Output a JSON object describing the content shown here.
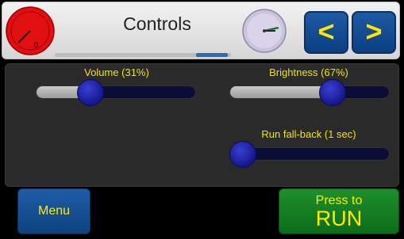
{
  "header": {
    "title": "Controls",
    "prev_label": "<",
    "next_label": ">",
    "gauge_label": "0",
    "gauge_icon": "speed-gauge-icon",
    "clock_icon": "clock-icon"
  },
  "sliders": [
    {
      "label": "Volume (31%)",
      "value": 0.31
    },
    {
      "label": "Brightness (67%)",
      "value": 0.67
    },
    {
      "label": "Run fall-back (1 sec)",
      "value": 0.0
    }
  ],
  "buttons": {
    "menu_label": "Menu",
    "run_line1": "Press to",
    "run_line2": "RUN"
  },
  "colors": {
    "label": "#f2e400",
    "track": "#0c0c38",
    "thumb": "#14178f",
    "nav": "#1e5aa3",
    "run": "#1e8f2a"
  }
}
